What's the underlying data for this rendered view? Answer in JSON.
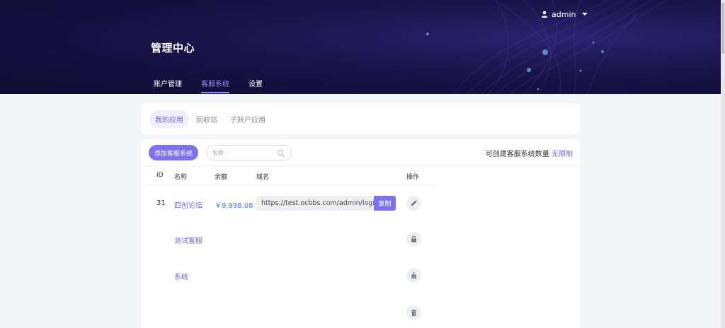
{
  "header": {
    "user_name": "admin",
    "title": "管理中心",
    "nav": [
      {
        "label": "账户管理",
        "active": false
      },
      {
        "label": "客服系统",
        "active": true
      },
      {
        "label": "设置",
        "active": false
      }
    ]
  },
  "subtabs": [
    {
      "label": "我的应用",
      "active": true
    },
    {
      "label": "回收站",
      "active": false
    },
    {
      "label": "子账户应用",
      "active": false
    }
  ],
  "toolbar": {
    "add_label": "添加客服系统",
    "search_placeholder": "名称",
    "quota_label": "可创建客服系统数量",
    "quota_value": "无限制"
  },
  "table": {
    "columns": [
      "ID",
      "名称",
      "余额",
      "域名",
      "操作"
    ],
    "row": {
      "id": "31",
      "names": [
        "四创论坛",
        "测试客服",
        "系统"
      ],
      "balance": "￥9,998.08",
      "domain": "https://test.ocbbs.com/admin/login/ind",
      "copy_label": "复制",
      "actions": [
        "pencil-icon",
        "lock-icon",
        "broom-icon",
        "trash-icon"
      ]
    }
  },
  "colors": {
    "accent": "#7d72ee",
    "link": "#6d6ad6",
    "balance": "#4a74e8",
    "header_bg": "#1d1650"
  }
}
